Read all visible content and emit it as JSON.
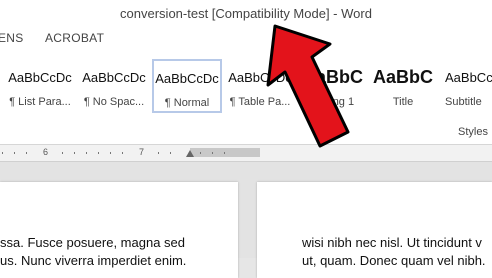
{
  "window": {
    "title": "conversion-test [Compatibility Mode] - Word"
  },
  "tabs": [
    {
      "label": "ENS"
    },
    {
      "label": "ACROBAT"
    }
  ],
  "styles_gallery": {
    "items": [
      {
        "sample": "AaBbCcDc",
        "label": "¶ List Para..."
      },
      {
        "sample": "AaBbCcDc",
        "label": "¶ No Spac..."
      },
      {
        "sample": "AaBbCcDc",
        "label": "¶ Normal",
        "selected": true
      },
      {
        "sample": "AaBbCcDc",
        "label": "¶ Table Pa..."
      },
      {
        "sample": "AaBbC",
        "label": "eading 1"
      },
      {
        "sample": "AaBbC",
        "label": "Title"
      },
      {
        "sample": "AaBbCcDc",
        "label": "Subtitle"
      }
    ],
    "group_label": "Styles"
  },
  "ruler": {
    "marks": [
      "6",
      "7"
    ]
  },
  "document": {
    "left_page_lines": [
      "ssa. Fusce posuere, magna sed",
      "us. Nunc viverra imperdiet enim."
    ],
    "right_page_lines": [
      "wisi nibh nec nisl. Ut tincidunt v",
      "ut, quam. Donec quam vel nibh."
    ]
  },
  "colors": {
    "arrow": "#e3131b",
    "selected_border": "#b7c9e8"
  }
}
